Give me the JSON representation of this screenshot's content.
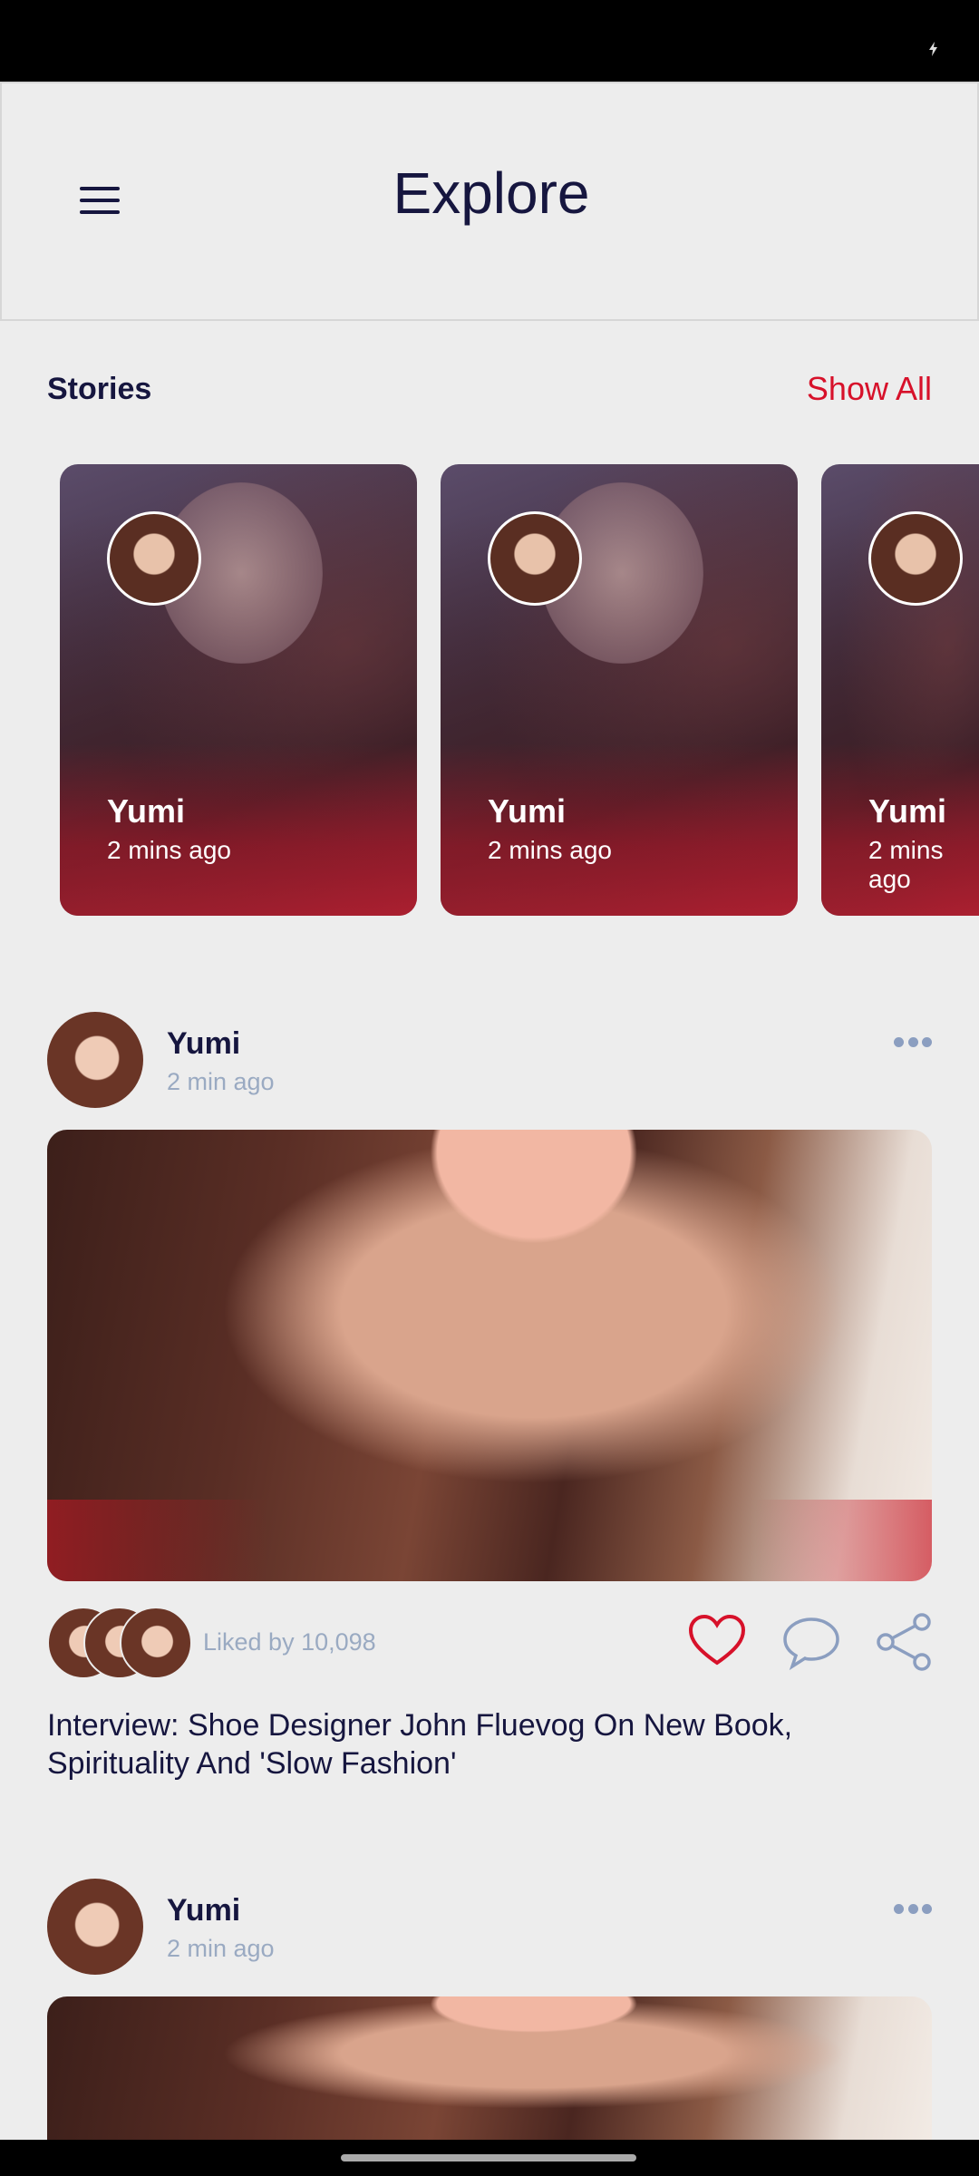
{
  "header": {
    "title": "Explore"
  },
  "stories": {
    "heading": "Stories",
    "show_all": "Show All",
    "items": [
      {
        "name": "Yumi",
        "time": "2 mins ago"
      },
      {
        "name": "Yumi",
        "time": "2 mins ago"
      },
      {
        "name": "Yumi",
        "time": "2 mins ago"
      }
    ]
  },
  "posts": [
    {
      "author": "Yumi",
      "time": "2 min ago",
      "liked_by": "Liked by 10,098",
      "caption": "Interview: Shoe Designer John Fluevog On New Book, Spirituality And 'Slow Fashion'"
    },
    {
      "author": "Yumi",
      "time": "2 min ago"
    }
  ],
  "colors": {
    "accent": "#d7112a",
    "text": "#16163f",
    "muted": "#9aaac2"
  }
}
